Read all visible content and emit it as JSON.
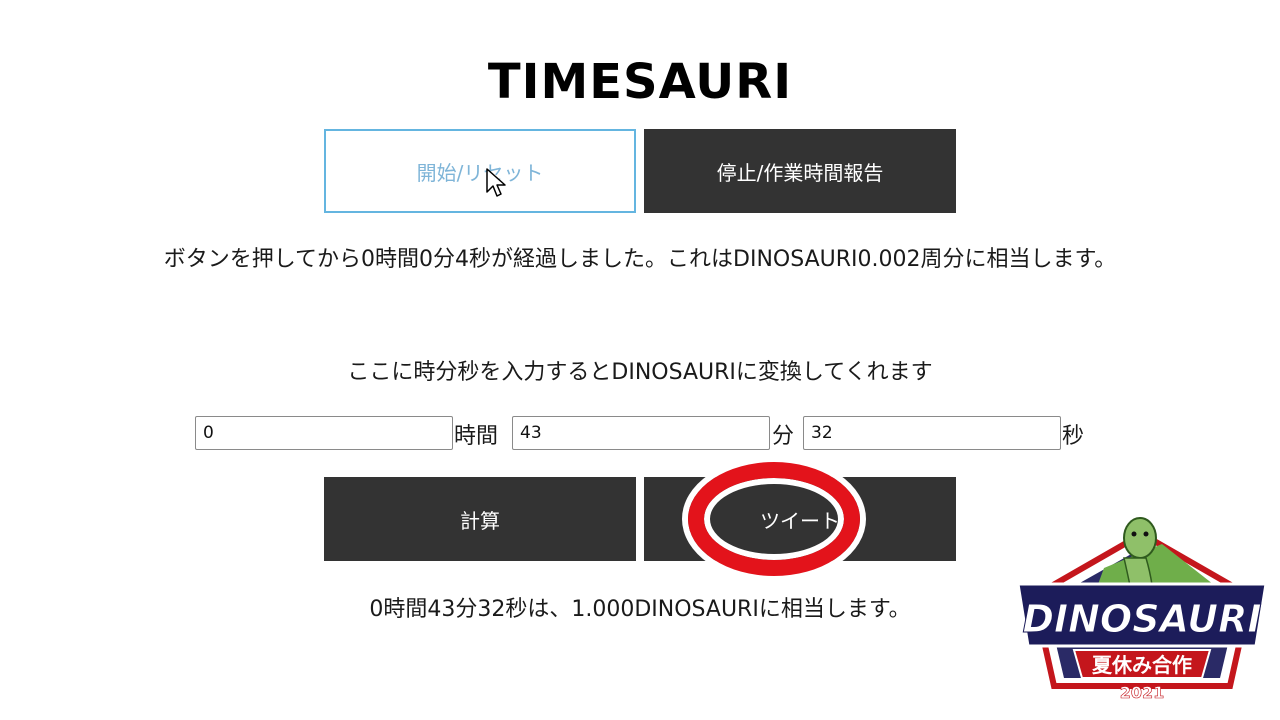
{
  "app": {
    "title": "TIMESAURI"
  },
  "timer": {
    "start_reset_label": "開始/リセット",
    "stop_report_label": "停止/作業時間報告",
    "elapsed_text": "ボタンを押してから0時間0分4秒が経過しました。これはDINOSAURI0.002周分に相当します。"
  },
  "converter": {
    "instruction": "ここに時分秒を入力するとDINOSAURIに変換してくれます",
    "hours_value": "0",
    "hours_unit": "時間",
    "minutes_value": "43",
    "minutes_unit": "分",
    "seconds_value": "32",
    "seconds_unit": "秒",
    "calculate_label": "計算",
    "tweet_label": "ツイート",
    "result_text": "0時間43分32秒は、1.000DINOSAURIに相当します。"
  },
  "badge": {
    "name": "DINOSAURI",
    "subtitle": "夏休み合作",
    "year": "2021"
  },
  "colors": {
    "dark_button": "#333333",
    "outline_border": "#64b5e0",
    "annotation_ring": "#e3131b"
  }
}
